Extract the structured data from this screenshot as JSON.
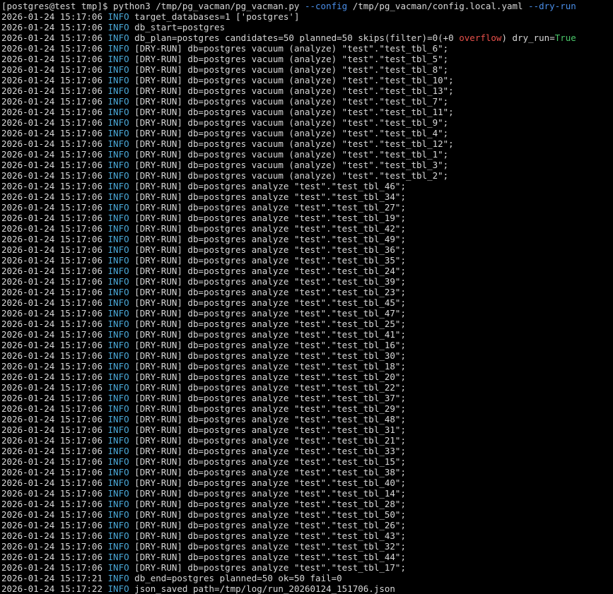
{
  "colors": {
    "background": "#000000",
    "text": "#d8d8d8",
    "level": "#4aa8d8",
    "flag": "#4a8ee8",
    "warn": "#e8504a",
    "ok": "#4ac86a"
  },
  "command": {
    "prompt": "[postgres@test tmp]$ ",
    "cmd": "python3 /tmp/pg_vacman/pg_vacman.py ",
    "flag1": "--config",
    "arg1": " /tmp/pg_vacman/config.local.yaml ",
    "flag2": "--dry-run"
  },
  "plan_line": {
    "ts": "2026-01-24 15:17:06",
    "level": "INFO",
    "msg_a": "db_plan=postgres candidates=50 planned=50 skips(filter)=0(+0 ",
    "msg_warn": "overflow",
    "msg_b": ") dry_run=",
    "msg_ok": "True"
  },
  "log_lines": [
    {
      "ts": "2026-01-24 15:17:06",
      "level": "INFO",
      "msg": "target_databases=1 ['postgres']"
    },
    {
      "ts": "2026-01-24 15:17:06",
      "level": "INFO",
      "msg": "db_start=postgres"
    },
    {
      "ts": "2026-01-24 15:17:06",
      "level": "INFO",
      "msg": "[DRY-RUN] db=postgres vacuum (analyze) \"test\".\"test_tbl_6\";"
    },
    {
      "ts": "2026-01-24 15:17:06",
      "level": "INFO",
      "msg": "[DRY-RUN] db=postgres vacuum (analyze) \"test\".\"test_tbl_5\";"
    },
    {
      "ts": "2026-01-24 15:17:06",
      "level": "INFO",
      "msg": "[DRY-RUN] db=postgres vacuum (analyze) \"test\".\"test_tbl_8\";"
    },
    {
      "ts": "2026-01-24 15:17:06",
      "level": "INFO",
      "msg": "[DRY-RUN] db=postgres vacuum (analyze) \"test\".\"test_tbl_10\";"
    },
    {
      "ts": "2026-01-24 15:17:06",
      "level": "INFO",
      "msg": "[DRY-RUN] db=postgres vacuum (analyze) \"test\".\"test_tbl_13\";"
    },
    {
      "ts": "2026-01-24 15:17:06",
      "level": "INFO",
      "msg": "[DRY-RUN] db=postgres vacuum (analyze) \"test\".\"test_tbl_7\";"
    },
    {
      "ts": "2026-01-24 15:17:06",
      "level": "INFO",
      "msg": "[DRY-RUN] db=postgres vacuum (analyze) \"test\".\"test_tbl_11\";"
    },
    {
      "ts": "2026-01-24 15:17:06",
      "level": "INFO",
      "msg": "[DRY-RUN] db=postgres vacuum (analyze) \"test\".\"test_tbl_9\";"
    },
    {
      "ts": "2026-01-24 15:17:06",
      "level": "INFO",
      "msg": "[DRY-RUN] db=postgres vacuum (analyze) \"test\".\"test_tbl_4\";"
    },
    {
      "ts": "2026-01-24 15:17:06",
      "level": "INFO",
      "msg": "[DRY-RUN] db=postgres vacuum (analyze) \"test\".\"test_tbl_12\";"
    },
    {
      "ts": "2026-01-24 15:17:06",
      "level": "INFO",
      "msg": "[DRY-RUN] db=postgres vacuum (analyze) \"test\".\"test_tbl_1\";"
    },
    {
      "ts": "2026-01-24 15:17:06",
      "level": "INFO",
      "msg": "[DRY-RUN] db=postgres vacuum (analyze) \"test\".\"test_tbl_3\";"
    },
    {
      "ts": "2026-01-24 15:17:06",
      "level": "INFO",
      "msg": "[DRY-RUN] db=postgres vacuum (analyze) \"test\".\"test_tbl_2\";"
    },
    {
      "ts": "2026-01-24 15:17:06",
      "level": "INFO",
      "msg": "[DRY-RUN] db=postgres analyze \"test\".\"test_tbl_46\";"
    },
    {
      "ts": "2026-01-24 15:17:06",
      "level": "INFO",
      "msg": "[DRY-RUN] db=postgres analyze \"test\".\"test_tbl_34\";"
    },
    {
      "ts": "2026-01-24 15:17:06",
      "level": "INFO",
      "msg": "[DRY-RUN] db=postgres analyze \"test\".\"test_tbl_27\";"
    },
    {
      "ts": "2026-01-24 15:17:06",
      "level": "INFO",
      "msg": "[DRY-RUN] db=postgres analyze \"test\".\"test_tbl_19\";"
    },
    {
      "ts": "2026-01-24 15:17:06",
      "level": "INFO",
      "msg": "[DRY-RUN] db=postgres analyze \"test\".\"test_tbl_42\";"
    },
    {
      "ts": "2026-01-24 15:17:06",
      "level": "INFO",
      "msg": "[DRY-RUN] db=postgres analyze \"test\".\"test_tbl_49\";"
    },
    {
      "ts": "2026-01-24 15:17:06",
      "level": "INFO",
      "msg": "[DRY-RUN] db=postgres analyze \"test\".\"test_tbl_36\";"
    },
    {
      "ts": "2026-01-24 15:17:06",
      "level": "INFO",
      "msg": "[DRY-RUN] db=postgres analyze \"test\".\"test_tbl_35\";"
    },
    {
      "ts": "2026-01-24 15:17:06",
      "level": "INFO",
      "msg": "[DRY-RUN] db=postgres analyze \"test\".\"test_tbl_24\";"
    },
    {
      "ts": "2026-01-24 15:17:06",
      "level": "INFO",
      "msg": "[DRY-RUN] db=postgres analyze \"test\".\"test_tbl_39\";"
    },
    {
      "ts": "2026-01-24 15:17:06",
      "level": "INFO",
      "msg": "[DRY-RUN] db=postgres analyze \"test\".\"test_tbl_23\";"
    },
    {
      "ts": "2026-01-24 15:17:06",
      "level": "INFO",
      "msg": "[DRY-RUN] db=postgres analyze \"test\".\"test_tbl_45\";"
    },
    {
      "ts": "2026-01-24 15:17:06",
      "level": "INFO",
      "msg": "[DRY-RUN] db=postgres analyze \"test\".\"test_tbl_47\";"
    },
    {
      "ts": "2026-01-24 15:17:06",
      "level": "INFO",
      "msg": "[DRY-RUN] db=postgres analyze \"test\".\"test_tbl_25\";"
    },
    {
      "ts": "2026-01-24 15:17:06",
      "level": "INFO",
      "msg": "[DRY-RUN] db=postgres analyze \"test\".\"test_tbl_41\";"
    },
    {
      "ts": "2026-01-24 15:17:06",
      "level": "INFO",
      "msg": "[DRY-RUN] db=postgres analyze \"test\".\"test_tbl_16\";"
    },
    {
      "ts": "2026-01-24 15:17:06",
      "level": "INFO",
      "msg": "[DRY-RUN] db=postgres analyze \"test\".\"test_tbl_30\";"
    },
    {
      "ts": "2026-01-24 15:17:06",
      "level": "INFO",
      "msg": "[DRY-RUN] db=postgres analyze \"test\".\"test_tbl_18\";"
    },
    {
      "ts": "2026-01-24 15:17:06",
      "level": "INFO",
      "msg": "[DRY-RUN] db=postgres analyze \"test\".\"test_tbl_20\";"
    },
    {
      "ts": "2026-01-24 15:17:06",
      "level": "INFO",
      "msg": "[DRY-RUN] db=postgres analyze \"test\".\"test_tbl_22\";"
    },
    {
      "ts": "2026-01-24 15:17:06",
      "level": "INFO",
      "msg": "[DRY-RUN] db=postgres analyze \"test\".\"test_tbl_37\";"
    },
    {
      "ts": "2026-01-24 15:17:06",
      "level": "INFO",
      "msg": "[DRY-RUN] db=postgres analyze \"test\".\"test_tbl_29\";"
    },
    {
      "ts": "2026-01-24 15:17:06",
      "level": "INFO",
      "msg": "[DRY-RUN] db=postgres analyze \"test\".\"test_tbl_48\";"
    },
    {
      "ts": "2026-01-24 15:17:06",
      "level": "INFO",
      "msg": "[DRY-RUN] db=postgres analyze \"test\".\"test_tbl_31\";"
    },
    {
      "ts": "2026-01-24 15:17:06",
      "level": "INFO",
      "msg": "[DRY-RUN] db=postgres analyze \"test\".\"test_tbl_21\";"
    },
    {
      "ts": "2026-01-24 15:17:06",
      "level": "INFO",
      "msg": "[DRY-RUN] db=postgres analyze \"test\".\"test_tbl_33\";"
    },
    {
      "ts": "2026-01-24 15:17:06",
      "level": "INFO",
      "msg": "[DRY-RUN] db=postgres analyze \"test\".\"test_tbl_15\";"
    },
    {
      "ts": "2026-01-24 15:17:06",
      "level": "INFO",
      "msg": "[DRY-RUN] db=postgres analyze \"test\".\"test_tbl_38\";"
    },
    {
      "ts": "2026-01-24 15:17:06",
      "level": "INFO",
      "msg": "[DRY-RUN] db=postgres analyze \"test\".\"test_tbl_40\";"
    },
    {
      "ts": "2026-01-24 15:17:06",
      "level": "INFO",
      "msg": "[DRY-RUN] db=postgres analyze \"test\".\"test_tbl_14\";"
    },
    {
      "ts": "2026-01-24 15:17:06",
      "level": "INFO",
      "msg": "[DRY-RUN] db=postgres analyze \"test\".\"test_tbl_28\";"
    },
    {
      "ts": "2026-01-24 15:17:06",
      "level": "INFO",
      "msg": "[DRY-RUN] db=postgres analyze \"test\".\"test_tbl_50\";"
    },
    {
      "ts": "2026-01-24 15:17:06",
      "level": "INFO",
      "msg": "[DRY-RUN] db=postgres analyze \"test\".\"test_tbl_26\";"
    },
    {
      "ts": "2026-01-24 15:17:06",
      "level": "INFO",
      "msg": "[DRY-RUN] db=postgres analyze \"test\".\"test_tbl_43\";"
    },
    {
      "ts": "2026-01-24 15:17:06",
      "level": "INFO",
      "msg": "[DRY-RUN] db=postgres analyze \"test\".\"test_tbl_32\";"
    },
    {
      "ts": "2026-01-24 15:17:06",
      "level": "INFO",
      "msg": "[DRY-RUN] db=postgres analyze \"test\".\"test_tbl_44\";"
    },
    {
      "ts": "2026-01-24 15:17:06",
      "level": "INFO",
      "msg": "[DRY-RUN] db=postgres analyze \"test\".\"test_tbl_17\";"
    },
    {
      "ts": "2026-01-24 15:17:21",
      "level": "INFO",
      "msg": "db_end=postgres planned=50 ok=50 fail=0"
    },
    {
      "ts": "2026-01-24 15:17:22",
      "level": "INFO",
      "msg": "json_saved path=/tmp/log/run_20260124_151706.json"
    }
  ]
}
